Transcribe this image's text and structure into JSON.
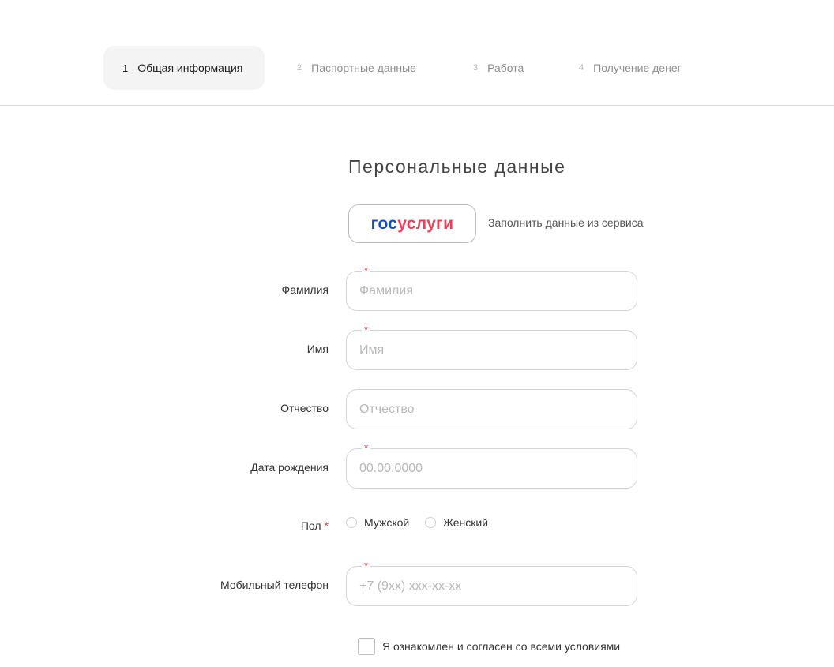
{
  "steps": [
    {
      "num": "1",
      "label": "Общая информация",
      "active": true
    },
    {
      "num": "2",
      "label": "Паспортные данные",
      "active": false
    },
    {
      "num": "3",
      "label": "Работа",
      "active": false
    },
    {
      "num": "4",
      "label": "Получение денег",
      "active": false
    }
  ],
  "title": "Персональные данные",
  "gosuslugi": {
    "logo_part1": "гос",
    "logo_part2": "услуги",
    "caption": "Заполнить данные из сервиса"
  },
  "fields": {
    "surname": {
      "label": "Фамилия",
      "placeholder": "Фамилия",
      "value": "",
      "required": "*"
    },
    "name": {
      "label": "Имя",
      "placeholder": "Имя",
      "value": "",
      "required": "*"
    },
    "patronymic": {
      "label": "Отчество",
      "placeholder": "Отчество",
      "value": ""
    },
    "birthdate": {
      "label": "Дата рождения",
      "placeholder": "00.00.0000",
      "value": "",
      "required": "*"
    },
    "phone": {
      "label": "Мобильный телефон",
      "placeholder": "+7 (9xx) xxx-xx-xx",
      "value": "",
      "required": "*"
    }
  },
  "gender": {
    "label": "Пол",
    "required": "*",
    "options": [
      "Мужской",
      "Женский"
    ]
  },
  "agreement": {
    "label": "Я ознакомлен и согласен со всеми условиями"
  },
  "colors": {
    "accent_red": "#e53946",
    "gos_blue": "#0d4cd3",
    "gos_red": "#ee3f58"
  }
}
